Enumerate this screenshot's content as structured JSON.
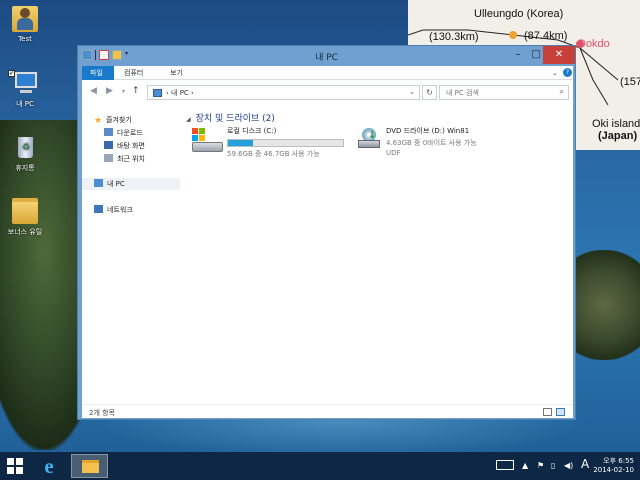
{
  "map": {
    "places": [
      {
        "name": "Ulleungdo (Korea)",
        "bold": false,
        "red": false
      },
      {
        "name": "Dokdo",
        "bold": false,
        "red": true
      },
      {
        "name": "Oki island",
        "bold": false,
        "red": false
      },
      {
        "name": "(Japan)",
        "bold": true,
        "red": false
      }
    ],
    "distances": [
      "(130.3km)",
      "(87.4km)",
      "(157"
    ]
  },
  "desktop": {
    "icons": [
      {
        "label": "Test",
        "icon": "user-folder-icon"
      },
      {
        "label": "내 PC",
        "icon": "computer-icon"
      },
      {
        "label": "휴지통",
        "icon": "recycle-bin-icon"
      },
      {
        "label": "보너스 유틸",
        "icon": "folder-icon"
      }
    ]
  },
  "explorer": {
    "title": "내 PC",
    "ribbon_tabs": [
      "파일",
      "컴퓨터",
      "보기"
    ],
    "address": "내 PC",
    "search_placeholder": "내 PC 검색",
    "nav": {
      "favorites": "즐겨찾기",
      "downloads": "다운로드",
      "desktop": "바탕 화면",
      "recent": "최근 위치",
      "this_pc": "내 PC",
      "network": "네트워크"
    },
    "group_title": "장치 및 드라이브 (2)",
    "drives": [
      {
        "name": "로컬 디스크 (C:)",
        "free_text": "59.6GB 중 46.7GB 사용 가능",
        "used_fraction": 0.22,
        "icon": "hard-drive-icon"
      },
      {
        "name": "DVD 드라이브 (D:) Win81",
        "free_text": "4.63GB 중 0바이트 사용 가능",
        "fs": "UDF",
        "icon": "dvd-drive-icon"
      }
    ],
    "status": "2개 항목"
  },
  "taskbar": {
    "clock_time": "오후 6:55",
    "clock_date": "2014-02-10",
    "ime_label": "A",
    "brand_colors": {
      "file_tab": "#1979ca",
      "close": "#c7413a",
      "progress": "#26a0da"
    }
  }
}
